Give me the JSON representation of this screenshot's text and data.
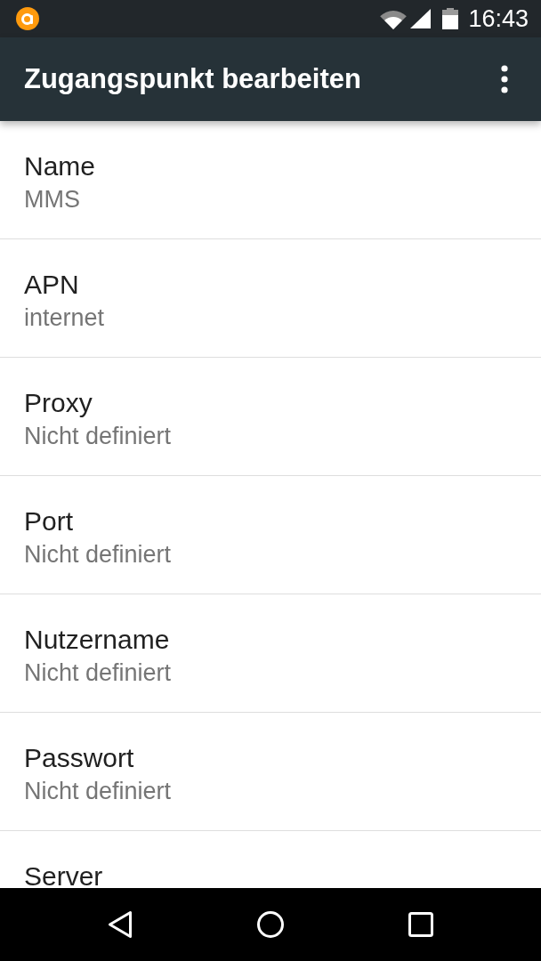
{
  "status_bar": {
    "time": "16:43"
  },
  "app_bar": {
    "title": "Zugangspunkt bearbeiten"
  },
  "settings": [
    {
      "title": "Name",
      "value": "MMS"
    },
    {
      "title": "APN",
      "value": "internet"
    },
    {
      "title": "Proxy",
      "value": "Nicht definiert"
    },
    {
      "title": "Port",
      "value": "Nicht definiert"
    },
    {
      "title": "Nutzername",
      "value": "Nicht definiert"
    },
    {
      "title": "Passwort",
      "value": "Nicht definiert"
    },
    {
      "title": "Server"
    }
  ]
}
